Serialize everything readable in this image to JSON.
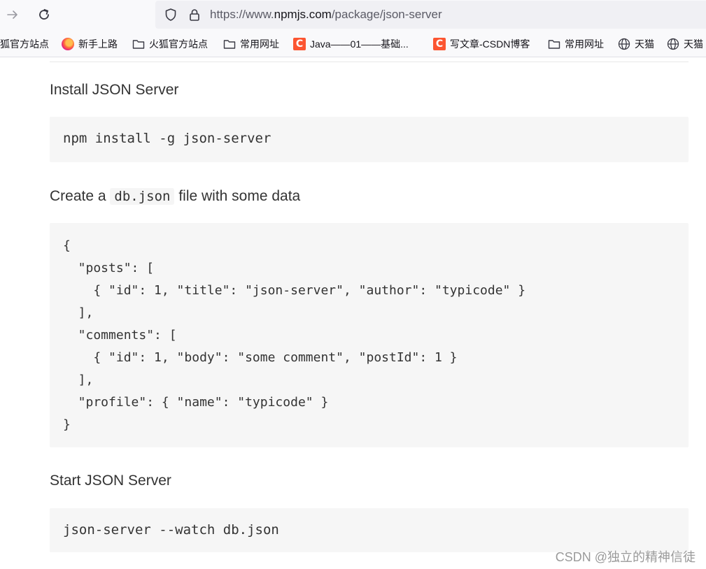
{
  "browser": {
    "url_prefix": "https://www.",
    "url_domain": "npmjs.com",
    "url_path": "/package/json-server"
  },
  "bookmarks": [
    {
      "label": "狐官方站点",
      "icon": "none"
    },
    {
      "label": "新手上路",
      "icon": "firefox-icon"
    },
    {
      "label": "火狐官方站点",
      "icon": "folder-icon"
    },
    {
      "label": "常用网址",
      "icon": "folder-icon"
    },
    {
      "label": "Java——01——基础...",
      "icon": "csdn-icon"
    },
    {
      "label": "写文章-CSDN博客",
      "icon": "csdn-icon"
    },
    {
      "label": "常用网址",
      "icon": "folder-icon"
    },
    {
      "label": "天猫",
      "icon": "globe-icon"
    },
    {
      "label": "天猫",
      "icon": "globe-icon"
    }
  ],
  "content": {
    "install_heading": "Install JSON Server",
    "install_cmd": "npm install -g json-server",
    "create_prefix": "Create a",
    "create_code": "db.json",
    "create_suffix": "file with some data",
    "json_lines": [
      "{",
      "  \"posts\": [",
      "    { \"id\": 1, \"title\": \"json-server\", \"author\": \"typicode\" }",
      "  ],",
      "  \"comments\": [",
      "    { \"id\": 1, \"body\": \"some comment\", \"postId\": 1 }",
      "  ],",
      "  \"profile\": { \"name\": \"typicode\" }",
      "}"
    ],
    "start_heading": "Start JSON Server",
    "start_cmd": "json-server --watch db.json"
  },
  "watermark": "CSDN @独立的精神信徒"
}
